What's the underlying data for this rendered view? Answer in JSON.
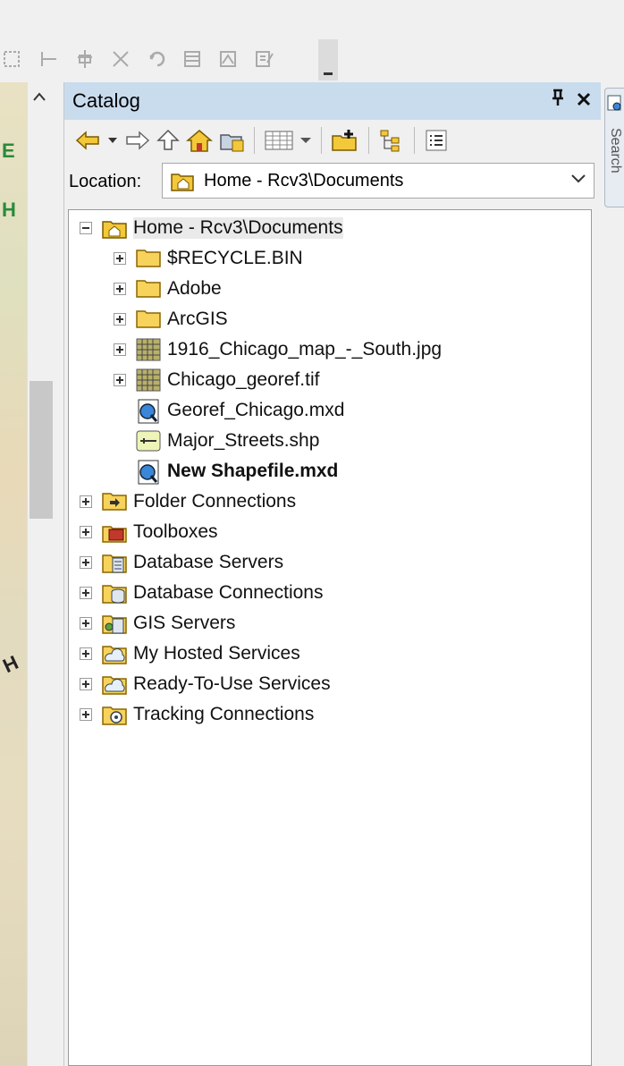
{
  "catalog": {
    "title": "Catalog",
    "location_label": "Location:",
    "location_value": "Home - Rcv3\\Documents"
  },
  "search_tab": {
    "label": "Search"
  },
  "tree": {
    "root": "Home - Rcv3\\Documents",
    "children": [
      {
        "label": "$RECYCLE.BIN",
        "icon": "folder-icon"
      },
      {
        "label": "Adobe",
        "icon": "folder-icon"
      },
      {
        "label": "ArcGIS",
        "icon": "folder-icon"
      },
      {
        "label": "1916_Chicago_map_-_South.jpg",
        "icon": "raster-icon"
      },
      {
        "label": "Chicago_georef.tif",
        "icon": "raster-icon"
      },
      {
        "label": "Georef_Chicago.mxd",
        "icon": "map-document-icon"
      },
      {
        "label": "Major_Streets.shp",
        "icon": "line-shapefile-icon"
      },
      {
        "label": "New Shapefile.mxd",
        "icon": "map-document-icon"
      }
    ],
    "top_level": [
      {
        "label": "Folder Connections",
        "icon": "folder-connection-icon"
      },
      {
        "label": "Toolboxes",
        "icon": "toolbox-icon"
      },
      {
        "label": "Database Servers",
        "icon": "database-server-icon"
      },
      {
        "label": "Database Connections",
        "icon": "database-connection-icon"
      },
      {
        "label": "GIS Servers",
        "icon": "gis-server-icon"
      },
      {
        "label": "My Hosted Services",
        "icon": "hosted-services-icon"
      },
      {
        "label": "Ready-To-Use Services",
        "icon": "ready-services-icon"
      },
      {
        "label": "Tracking Connections",
        "icon": "tracking-icon"
      }
    ]
  },
  "map_strip": {
    "letters": [
      "E",
      "H",
      "H"
    ]
  }
}
